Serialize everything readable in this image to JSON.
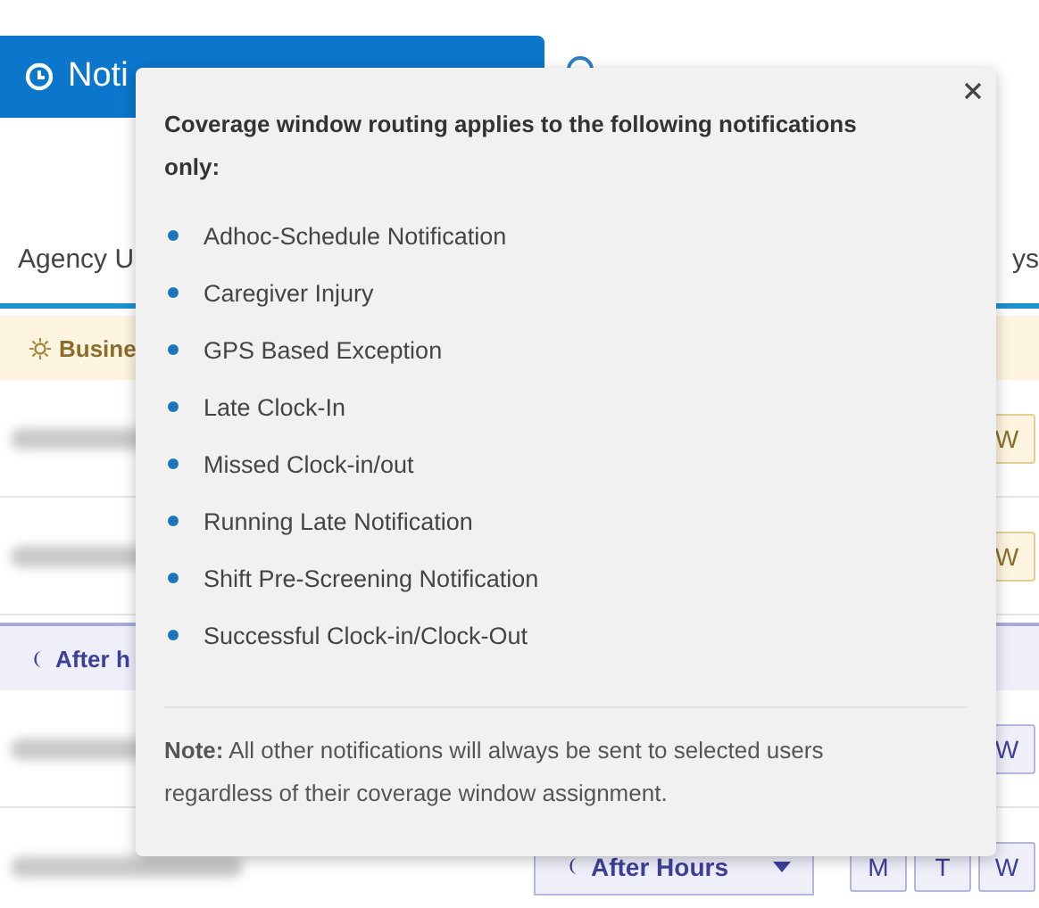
{
  "header_button": {
    "label": "Noti"
  },
  "table": {
    "columns": [
      "Agency U",
      "ys"
    ],
    "groups": [
      {
        "kind": "business",
        "label": "Busine",
        "rows": [
          {
            "days": [
              "W"
            ]
          },
          {
            "days": [
              "W"
            ]
          }
        ]
      },
      {
        "kind": "after_hours",
        "label": "After h",
        "rows": [
          {
            "days": [
              "W"
            ]
          },
          {
            "dropdown": "After Hours",
            "days": [
              "M",
              "T",
              "W"
            ]
          }
        ]
      }
    ]
  },
  "popover": {
    "title": "Coverage window routing applies to the following notifications only:",
    "items": [
      "Adhoc-Schedule Notification",
      "Caregiver Injury",
      "GPS Based Exception",
      "Late Clock-In",
      "Missed Clock-in/out",
      "Running Late Notification",
      "Shift Pre-Screening Notification",
      "Successful Clock-in/Clock-Out"
    ],
    "note": "**Note:** All other notifications will always be sent to selected users regardless of their coverage window assignment."
  }
}
